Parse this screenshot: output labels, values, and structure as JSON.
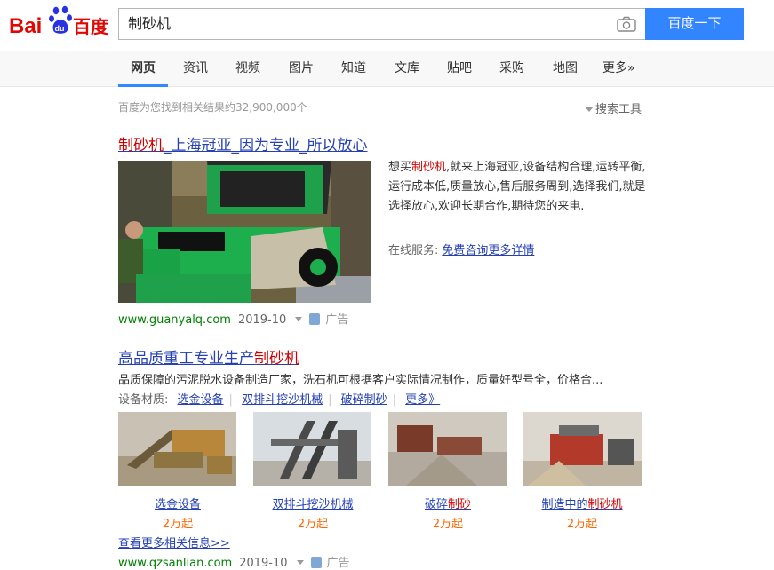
{
  "header": {
    "logo_text_left": "Bai",
    "logo_paw_text": "du",
    "logo_text_right": "百度",
    "search_value": "制砂机",
    "search_button": "百度一下"
  },
  "tabs": [
    {
      "label": "网页",
      "active": true
    },
    {
      "label": "资讯"
    },
    {
      "label": "视频"
    },
    {
      "label": "图片"
    },
    {
      "label": "知道"
    },
    {
      "label": "文库"
    },
    {
      "label": "贴吧"
    },
    {
      "label": "采购"
    },
    {
      "label": "地图"
    },
    {
      "label": "更多»"
    }
  ],
  "result_count": "百度为您找到相关结果约32,900,000个",
  "search_tools": "搜索工具",
  "result1": {
    "title_hl": "制砂机",
    "title_rest": "_上海冠亚_因为专业_所以放心",
    "desc_pre": "想买",
    "desc_hl": "制砂机",
    "desc_post": ",就来上海冠亚,设备结构合理,运转平衡,运行成本低,质量放心,售后服务周到,选择我们,就是选择放心,欢迎长期合作,期待您的来电.",
    "service_label": "在线服务:",
    "service_link": "免费咨询更多详情",
    "url": "www.guanyalq.com",
    "date": "2019-10",
    "ad_label": "广告"
  },
  "result2": {
    "title_pre": "高品质重工专业生产",
    "title_hl": "制砂机",
    "desc": "品质保障的污泥脱水设备制造厂家，洗石机可根据客户实际情况制作，质量好型号全，价格合...",
    "materials_label": "设备材质:",
    "materials": [
      "选金设备",
      "双排斗挖沙机械",
      "破碎制砂",
      "更多》"
    ],
    "thumbs": [
      {
        "pre": "选金设备",
        "hl": "",
        "price": "2万起"
      },
      {
        "pre": "双排斗挖沙机械",
        "hl": "",
        "price": "2万起"
      },
      {
        "pre": "破碎",
        "hl": "制砂",
        "price": "2万起"
      },
      {
        "pre": "制造中的",
        "hl": "制砂机",
        "price": "2万起"
      }
    ],
    "more_link": "查看更多相关信息>>",
    "url": "www.qzsanlian.com",
    "date": "2019-10",
    "ad_label": "广告"
  }
}
